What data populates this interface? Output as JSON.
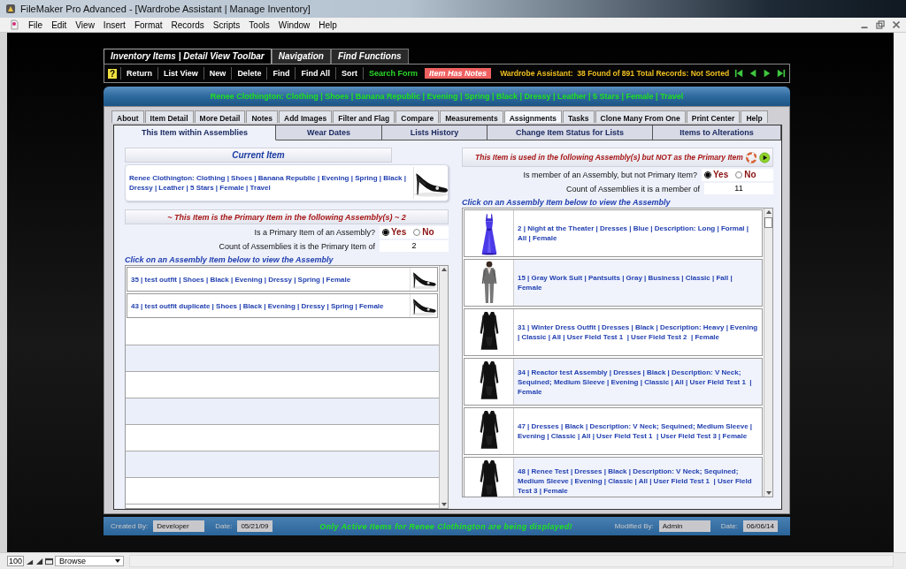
{
  "window": {
    "title": "FileMaker Pro Advanced - [Wardrobe Assistant | Manage Inventory]"
  },
  "menu": [
    "File",
    "Edit",
    "View",
    "Insert",
    "Format",
    "Records",
    "Scripts",
    "Tools",
    "Window",
    "Help"
  ],
  "toolbar_tabs": [
    {
      "label": "Inventory Items | Detail View Toolbar",
      "selected": true
    },
    {
      "label": "Navigation",
      "selected": false
    },
    {
      "label": "Find Functions",
      "selected": false
    }
  ],
  "toolbar": {
    "help": "?",
    "buttons": [
      "Return",
      "List View",
      "New",
      "Delete",
      "Find",
      "Find All",
      "Sort"
    ],
    "search_form": "Search Form",
    "notes_badge": "Item Has Notes",
    "status": "Wardrobe Assistant:  38 Found of 891 Total Records: Not Sorted"
  },
  "header": "Renee Clothington: Clothing | Shoes | Banana Republic | Evening | Spring | Black | Dressy | Leather | 5 Stars | Female | Travel",
  "tabs": [
    {
      "label": "About",
      "selected": false
    },
    {
      "label": "Item Detail",
      "selected": false
    },
    {
      "label": "More Detail",
      "selected": false
    },
    {
      "label": "Notes",
      "selected": false
    },
    {
      "label": "Add Images",
      "selected": false
    },
    {
      "label": "Filter and Flag",
      "selected": false
    },
    {
      "label": "Compare",
      "selected": false
    },
    {
      "label": "Measurements",
      "selected": false
    },
    {
      "label": "Assignments",
      "selected": true
    },
    {
      "label": "Tasks",
      "selected": false
    },
    {
      "label": "Clone Many From One",
      "selected": false
    },
    {
      "label": "Print Center",
      "selected": false
    },
    {
      "label": "Help",
      "selected": false
    }
  ],
  "subtabs": [
    {
      "label": "This Item within Assemblies",
      "selected": true
    },
    {
      "label": "Wear Dates",
      "selected": false
    },
    {
      "label": "Lists History",
      "selected": false
    },
    {
      "label": "Change Item Status for Lists",
      "selected": false
    },
    {
      "label": "Items to Alterations",
      "selected": false
    }
  ],
  "current_item": {
    "heading": "Current Item",
    "text": "Renee Clothington: Clothing | Shoes | Banana Republic | Evening | Spring | Black | Dressy | Leather | 5 Stars | Female | Travel"
  },
  "primary": {
    "heading": "~ This Item is the Primary Item in the following Assembly(s)  ~ 2",
    "question": "Is a Primary Item of an Assembly?",
    "options": [
      {
        "label": "Yes",
        "selected": true
      },
      {
        "label": "No",
        "selected": false
      }
    ],
    "count_label": "Count of Assemblies it is the Primary Item of",
    "count": "2",
    "hint": "Click on an Assembly Item below to view the Assembly",
    "items": [
      "35 | test outfit | Shoes | Black | Evening | Dressy | Spring | Female",
      "43 | test outfit duplicate | Shoes | Black | Evening | Dressy | Spring | Female"
    ]
  },
  "member": {
    "heading": "This Item is used in the following Assembly(s) but NOT as the Primary Item",
    "question": "Is member of an Assembly, but not Primary Item?",
    "options": [
      {
        "label": "Yes",
        "selected": true
      },
      {
        "label": "No",
        "selected": false
      }
    ],
    "count_label": "Count of Assemblies it is a  member of",
    "count": "11",
    "hint": "Click on an Assembly Item below to view the Assembly",
    "items": [
      "2 | Night at the Theater | Dresses | Blue | Description: Long | Formal | All | Female",
      "15 | Gray Work Suit | Pantsuits | Gray | Business | Classic | Fall | Female",
      "31 | Winter Dress Outfit | Dresses | Black | Description: Heavy | Evening | Classic | All | User Field Test 1  | User Field Test 2  | Female",
      "34 | Reactor test Assembly | Dresses | Black | Description: V Neck; Sequined; Medium Sleeve | Evening | Classic | All | User Field Test 1  | Female",
      "47 | Dresses | Black | Description: V Neck; Sequined; Medium Sleeve | Evening | Classic | All | User Field Test 1  | User Field Test 3 | Female",
      "48 | Renee Test | Dresses | Black | Description: V Neck; Sequined; Medium Sleeve | Evening | Classic | All | User Field Test 1  | User Field Test 3 | Female"
    ]
  },
  "footer": {
    "created_label": "Created By:",
    "created_by": "Developer",
    "created_date_label": "Date:",
    "created_date": "05/21/09",
    "message": "Only Active Items for Renee Clothington are being displayed!",
    "modified_label": "Modified By:",
    "modified_by": "Admin",
    "modified_date_label": "Date:",
    "modified_date": "06/06/14"
  },
  "status_bar": {
    "zoom": "100",
    "mode": "Browse"
  }
}
